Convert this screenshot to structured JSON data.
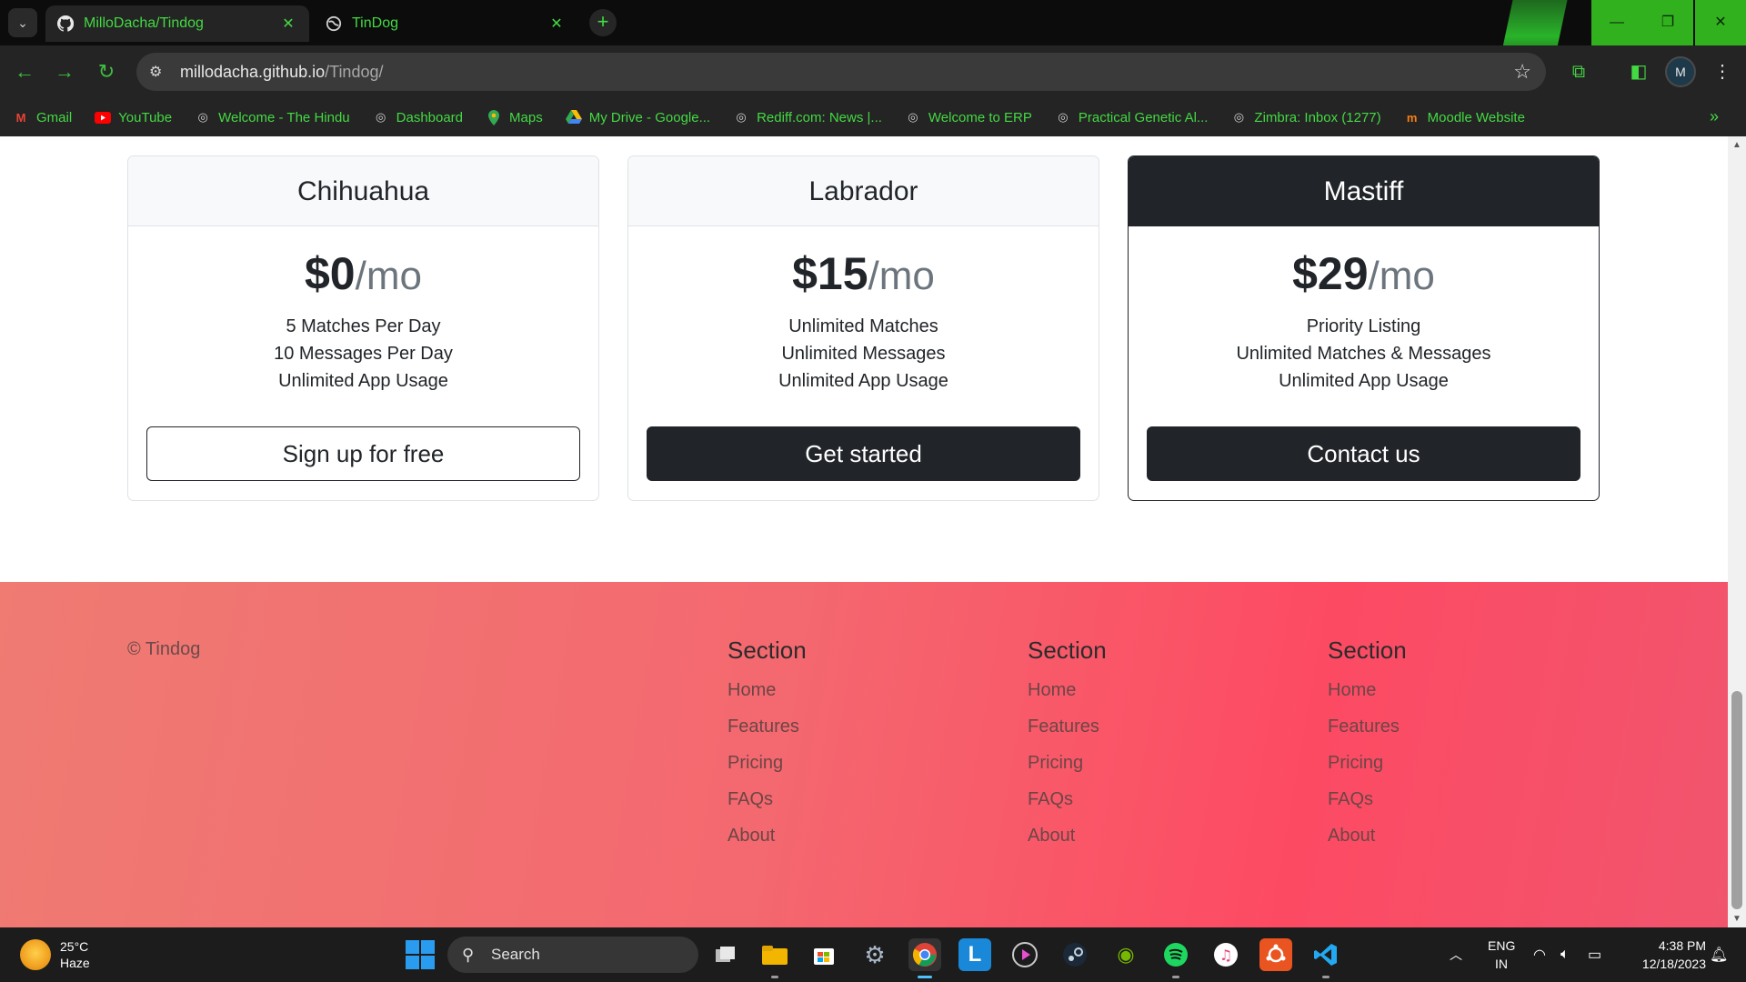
{
  "browser": {
    "tabs": [
      {
        "title": "MilloDacha/Tindog",
        "close": "✕"
      },
      {
        "title": "TinDog",
        "close": "✕"
      }
    ],
    "new_tab": "+",
    "url_host": "millodacha.github.io",
    "url_path": "/Tindog/",
    "profile_initial": "M",
    "window_controls": {
      "minimize": "—",
      "maximize": "❐",
      "close": "✕"
    },
    "bookmarks": [
      {
        "label": "Gmail",
        "icon": "gmail-icon"
      },
      {
        "label": "YouTube",
        "icon": "youtube-icon"
      },
      {
        "label": "Welcome - The Hindu",
        "icon": "globe-icon"
      },
      {
        "label": "Dashboard",
        "icon": "globe-icon"
      },
      {
        "label": "Maps",
        "icon": "maps-icon"
      },
      {
        "label": "My Drive - Google...",
        "icon": "drive-icon"
      },
      {
        "label": "Rediff.com: News |...",
        "icon": "globe-icon"
      },
      {
        "label": "Welcome to ERP",
        "icon": "globe-icon"
      },
      {
        "label": "Practical Genetic Al...",
        "icon": "globe-icon"
      },
      {
        "label": "Zimbra: Inbox (1277)",
        "icon": "globe-icon"
      },
      {
        "label": "Moodle Website",
        "icon": "moodle-icon"
      }
    ],
    "accent_color": "#43d943"
  },
  "pricing": {
    "plans": [
      {
        "name": "Chihuahua",
        "price": "$0",
        "per": "/mo",
        "features": [
          "5 Matches Per Day",
          "10 Messages Per Day",
          "Unlimited App Usage"
        ],
        "button": "Sign up for free"
      },
      {
        "name": "Labrador",
        "price": "$15",
        "per": "/mo",
        "features": [
          "Unlimited Matches",
          "Unlimited Messages",
          "Unlimited App Usage"
        ],
        "button": "Get started"
      },
      {
        "name": "Mastiff",
        "price": "$29",
        "per": "/mo",
        "features": [
          "Priority Listing",
          "Unlimited Matches & Messages",
          "Unlimited App Usage"
        ],
        "button": "Contact us"
      }
    ]
  },
  "footer": {
    "copyright": "© Tindog",
    "columns": [
      {
        "heading": "Section",
        "links": [
          "Home",
          "Features",
          "Pricing",
          "FAQs",
          "About"
        ]
      },
      {
        "heading": "Section",
        "links": [
          "Home",
          "Features",
          "Pricing",
          "FAQs",
          "About"
        ]
      },
      {
        "heading": "Section",
        "links": [
          "Home",
          "Features",
          "Pricing",
          "FAQs",
          "About"
        ]
      }
    ]
  },
  "taskbar": {
    "weather_temp": "25°C",
    "weather_desc": "Haze",
    "search_placeholder": "Search",
    "language_line1": "ENG",
    "language_line2": "IN",
    "time": "4:38 PM",
    "date": "12/18/2023"
  }
}
